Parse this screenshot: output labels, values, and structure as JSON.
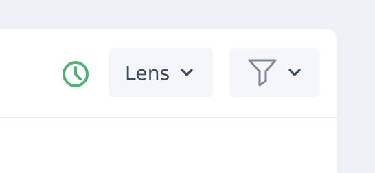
{
  "toolbar": {
    "history_icon": "clock-icon",
    "lens_dropdown": {
      "label": "Lens",
      "icon": "chevron-down-icon"
    },
    "filter_dropdown": {
      "icon": "funnel-icon",
      "chevron": "chevron-down-icon"
    }
  },
  "colors": {
    "accent_green": "#56b07a",
    "text": "#3b4a5c",
    "button_bg": "#f4f6fa"
  }
}
